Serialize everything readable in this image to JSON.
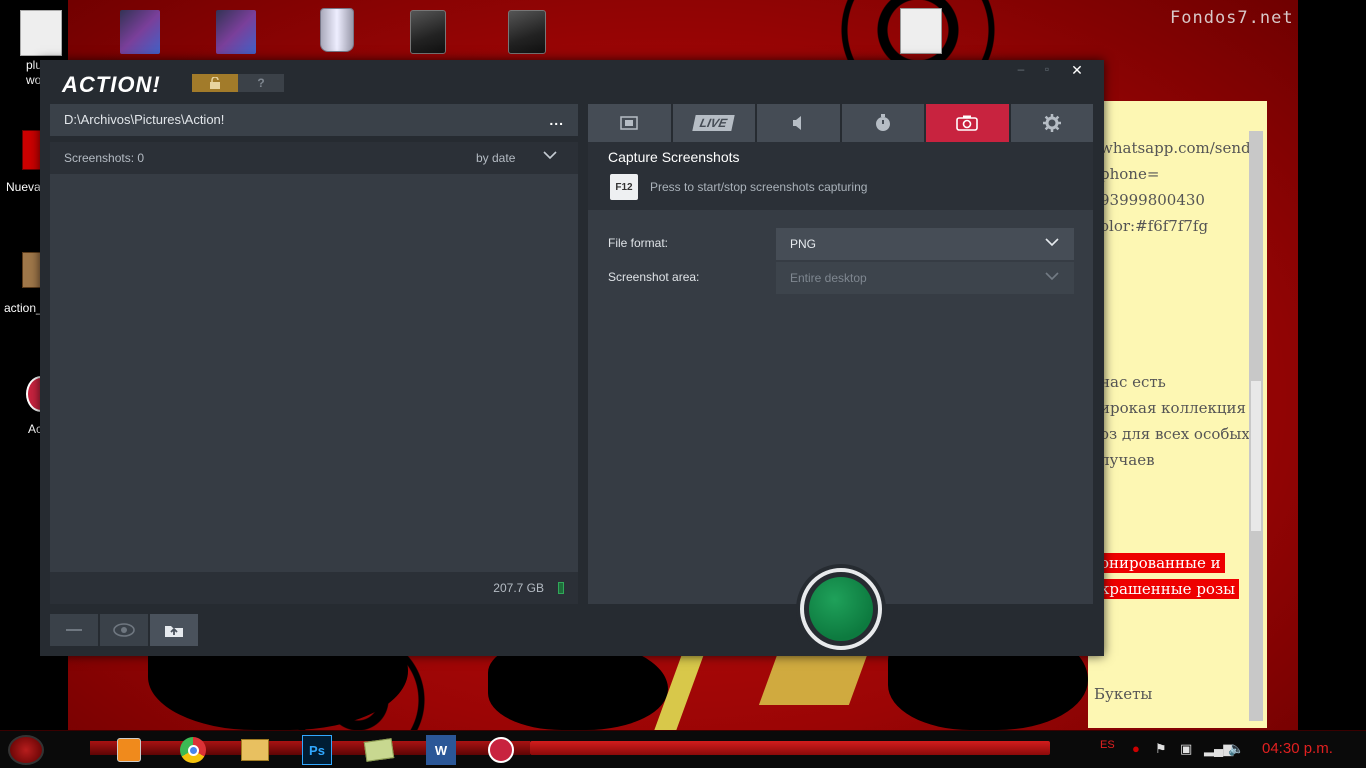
{
  "desktop": {
    "watermark": "Fondos7.net",
    "icons": [
      {
        "label": "plu\nword",
        "icon": "white-folder-icon"
      },
      {
        "label": "Nueva",
        "icon": "app-icon"
      },
      {
        "label": "action_",
        "icon": "package-icon"
      },
      {
        "label": "Ac",
        "icon": "action-icon"
      }
    ]
  },
  "sticky_note": {
    "lines": [
      "whatsapp.com/send",
      "phone=",
      "93999800430",
      "olor:#f6f7f7fg",
      " нас есть",
      "ирокая коллекция",
      "оз для всех особых",
      "лучаев",
      "онированные и",
      "крашенные розы",
      "Букеты"
    ]
  },
  "app": {
    "title": "ACTION!",
    "help_label": "?",
    "window_controls": {
      "minimize": "‒",
      "maximize": "▫",
      "close": "✕"
    },
    "left": {
      "path": "D:\\Archivos\\Pictures\\Action!",
      "path_more": "...",
      "count_label": "Screenshots: 0",
      "sort_label": "by date",
      "disk_space": "207.7 GB"
    },
    "tabs": [
      {
        "name": "video",
        "label": ""
      },
      {
        "name": "live",
        "label": "LIVE"
      },
      {
        "name": "audio",
        "label": ""
      },
      {
        "name": "benchmark",
        "label": ""
      },
      {
        "name": "screenshots",
        "label": "",
        "active": true
      },
      {
        "name": "settings",
        "label": ""
      }
    ],
    "right": {
      "title": "Capture Screenshots",
      "hotkey": "F12",
      "hotkey_desc": "Press to start/stop screenshots capturing",
      "file_format_label": "File format:",
      "file_format_value": "PNG",
      "area_label": "Screenshot area:",
      "area_value": "Entire desktop"
    },
    "colors": {
      "accent": "#c8233f",
      "record": "#0d7a3f",
      "lock": "#a27b2a"
    }
  },
  "taskbar": {
    "apps": [
      "media-player-icon",
      "chrome-icon",
      "file-explorer-icon",
      "photoshop-icon",
      "folder-icon",
      "word-icon",
      "action-record-icon"
    ],
    "photoshop_label": "Ps",
    "word_label": "W",
    "language": "ES",
    "clock": "04:30 p.m."
  }
}
